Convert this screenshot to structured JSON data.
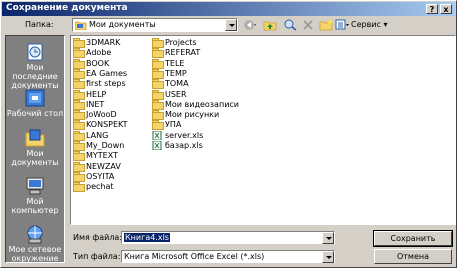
{
  "title": "Сохранение документа",
  "titlebar_buttons": {
    "help": "?",
    "close": "x"
  },
  "look_in": {
    "label": "Папка:",
    "value": "Мои документы"
  },
  "toolbar": {
    "service_label": "Сервис"
  },
  "places": [
    {
      "label": "Мои последние документы",
      "icon": "recent-icon"
    },
    {
      "label": "Рабочий стол",
      "icon": "desktop-icon"
    },
    {
      "label": "Мои документы",
      "icon": "my-documents-icon"
    },
    {
      "label": "Мой компьютер",
      "icon": "my-computer-icon"
    },
    {
      "label": "Мое сетевое окружение",
      "icon": "network-icon"
    }
  ],
  "files_col1": [
    "3DMARK",
    "Adobe",
    "BOOK",
    "EA Games",
    "first steps",
    "HELP",
    "INET",
    "JoWooD",
    "KONSPEKT",
    "LANG",
    "My_Down",
    "MYTEXT",
    "NEWZAV",
    "OSYITA",
    "pechat"
  ],
  "files_col2": [
    {
      "name": "Projects",
      "type": "folder"
    },
    {
      "name": "REFERAT",
      "type": "folder"
    },
    {
      "name": "TELE",
      "type": "folder"
    },
    {
      "name": "TEMP",
      "type": "folder"
    },
    {
      "name": "TOMA",
      "type": "folder"
    },
    {
      "name": "USER",
      "type": "folder"
    },
    {
      "name": "Мои видеозаписи",
      "type": "folder"
    },
    {
      "name": "Мои рисунки",
      "type": "folder"
    },
    {
      "name": "УПА",
      "type": "folder"
    },
    {
      "name": "server.xls",
      "type": "xls"
    },
    {
      "name": "базар.xls",
      "type": "xls"
    }
  ],
  "filename": {
    "label": "Имя файла:",
    "value": "Книга4.xls"
  },
  "filetype": {
    "label": "Тип файла:",
    "value": "Книга Microsoft Office Excel (*.xls)"
  },
  "buttons": {
    "save": "Сохранить",
    "cancel": "Отмена"
  }
}
